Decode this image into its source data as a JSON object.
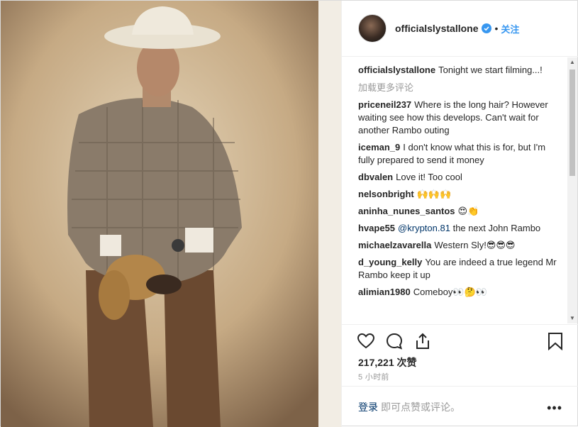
{
  "post": {
    "username": "officialslystallone",
    "follow_label": "关注",
    "dot": "•",
    "caption": "Tonight we start filming...!",
    "load_more": "加载更多评论",
    "likes": "217,221 次赞",
    "time": "5 小时前",
    "login_link": "登录",
    "login_text": "即可点赞或评论。",
    "more": "•••"
  },
  "comments": [
    {
      "user": "priceneil237",
      "text": "Where is the long hair? However waiting see how this develops. Can't wait for another Rambo outing"
    },
    {
      "user": "iceman_9",
      "text": "I don't know what this is for, but I'm fully prepared to send it money"
    },
    {
      "user": "dbvalen",
      "text": "Love it! Too cool"
    },
    {
      "user": "nelsonbright",
      "text": "🙌🙌🙌"
    },
    {
      "user": "aninha_nunes_santos",
      "text": "😍👏"
    },
    {
      "user": "hvape55",
      "mention": "@krypton.81",
      "text": "the next John Rambo"
    },
    {
      "user": "michaelzavarella",
      "text": "Western Sly!😎😎😎"
    },
    {
      "user": "d_young_kelly",
      "text": "You are indeed a true legend Mr Rambo keep it up"
    },
    {
      "user": "alimian1980",
      "text": "Comeboy👀🤔👀"
    }
  ],
  "icons": {
    "verified": "verified-badge-icon",
    "like": "heart-icon",
    "comment": "comment-bubble-icon",
    "share": "share-icon",
    "save": "bookmark-icon",
    "more": "more-dots-icon"
  },
  "colors": {
    "link_blue": "#3897f0",
    "dark_link": "#003569",
    "muted": "#999999",
    "text": "#262626"
  }
}
